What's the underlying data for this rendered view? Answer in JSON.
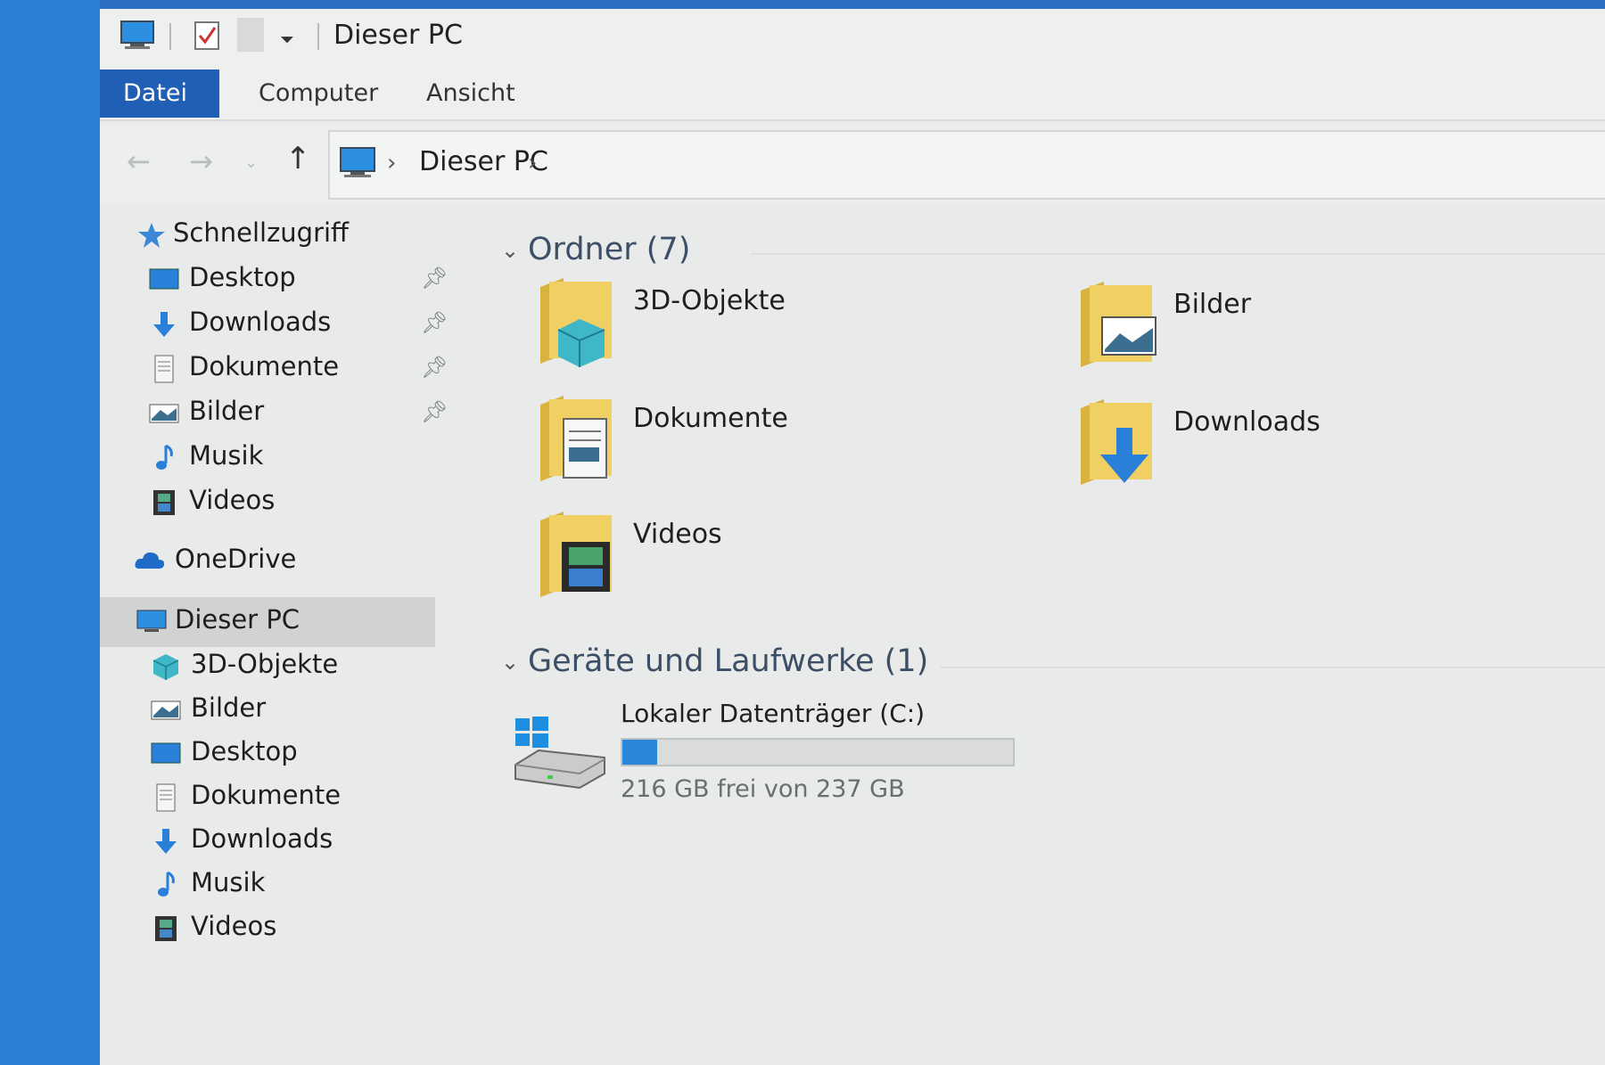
{
  "window": {
    "title": "Dieser PC"
  },
  "ribbon": {
    "tabs": [
      "Datei",
      "Computer",
      "Ansicht"
    ]
  },
  "address": {
    "path": "Dieser PC"
  },
  "sidebar": {
    "quick_access": "Schnellzugriff",
    "quick_items": [
      {
        "label": "Desktop",
        "icon": "desktop-icon",
        "pinned": true
      },
      {
        "label": "Downloads",
        "icon": "download-arrow-icon",
        "pinned": true
      },
      {
        "label": "Dokumente",
        "icon": "document-icon",
        "pinned": true
      },
      {
        "label": "Bilder",
        "icon": "picture-icon",
        "pinned": true
      },
      {
        "label": "Musik",
        "icon": "music-note-icon",
        "pinned": false
      },
      {
        "label": "Videos",
        "icon": "film-icon",
        "pinned": false
      }
    ],
    "onedrive": "OneDrive",
    "this_pc": "Dieser PC",
    "pc_items": [
      {
        "label": "3D-Objekte",
        "icon": "cube-icon"
      },
      {
        "label": "Bilder",
        "icon": "picture-icon"
      },
      {
        "label": "Desktop",
        "icon": "desktop-icon"
      },
      {
        "label": "Dokumente",
        "icon": "document-icon"
      },
      {
        "label": "Downloads",
        "icon": "download-arrow-icon"
      },
      {
        "label": "Musik",
        "icon": "music-note-icon"
      },
      {
        "label": "Videos",
        "icon": "film-icon"
      }
    ]
  },
  "content": {
    "folders_header": "Ordner (7)",
    "folders": [
      {
        "label": "3D-Objekte",
        "icon": "folder-3d-objects-icon"
      },
      {
        "label": "Bilder",
        "icon": "folder-pictures-icon"
      },
      {
        "label": "Dokumente",
        "icon": "folder-documents-icon"
      },
      {
        "label": "Downloads",
        "icon": "folder-downloads-icon"
      },
      {
        "label": "Videos",
        "icon": "folder-videos-icon"
      }
    ],
    "devices_header": "Geräte und Laufwerke (1)",
    "drive": {
      "name": "Lokaler Datenträger (C:)",
      "free_text": "216 GB frei von 237 GB",
      "used_fraction": 0.09
    }
  },
  "colors": {
    "accent": "#1f5fb5",
    "desktop_bg": "#2b7fd6",
    "drive_fill": "#2a86d8",
    "folder_yellow": "#e8c454"
  }
}
